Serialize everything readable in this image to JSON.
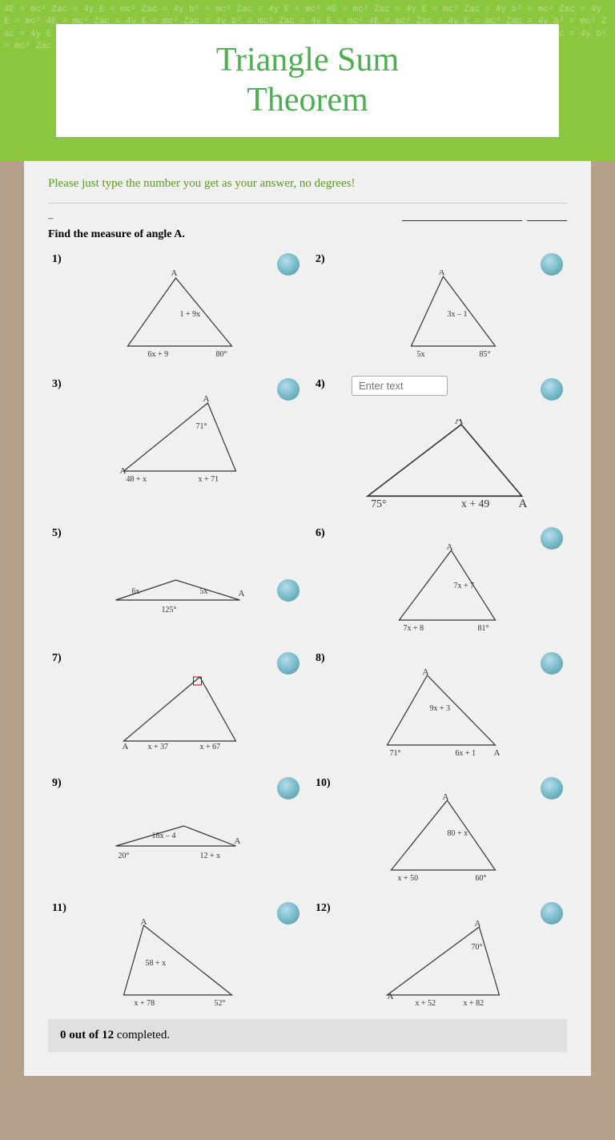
{
  "header": {
    "title": "Triangle Sum\nTheorem",
    "math_pattern": "4E = mc² Zac = 4y E = mc² Zac = 4y b²"
  },
  "instruction": "Please just type the number you get as your answer, no degrees!",
  "find_text": "Find the measure of angle A.",
  "name_label": "–",
  "completion": {
    "count": "0",
    "total": "12",
    "text": "completed."
  },
  "problems": [
    {
      "number": "1)",
      "type": "triangle",
      "angles": [
        "1 + 9x",
        "6x + 9",
        "80°"
      ],
      "vertex_label": "A",
      "has_input": false
    },
    {
      "number": "2)",
      "type": "triangle",
      "angles": [
        "3x – 1",
        "5x",
        "85°"
      ],
      "vertex_label": "A",
      "has_input": false
    },
    {
      "number": "3)",
      "type": "triangle",
      "angles": [
        "71°",
        "48 + x",
        "x + 71"
      ],
      "vertex_label": "A",
      "has_input": false
    },
    {
      "number": "4)",
      "type": "triangle",
      "angles": [
        "75°",
        "x + 49"
      ],
      "vertex_label": "A",
      "has_input": true,
      "input_placeholder": "Enter text"
    },
    {
      "number": "5)",
      "type": "flat_triangle",
      "angles": [
        "6x",
        "5x",
        "125°"
      ],
      "vertex_label": "A",
      "has_input": false
    },
    {
      "number": "6)",
      "type": "triangle",
      "angles": [
        "7x + 7",
        "7x + 8",
        "81°"
      ],
      "vertex_label": "A",
      "has_input": false
    },
    {
      "number": "7)",
      "type": "triangle",
      "angles": [
        "x + 37",
        "x + 67"
      ],
      "vertex_label": "A",
      "has_input": false
    },
    {
      "number": "8)",
      "type": "triangle",
      "angles": [
        "9x + 3",
        "71°",
        "6x + 1"
      ],
      "vertex_label": "A",
      "has_input": false
    },
    {
      "number": "9)",
      "type": "flat_triangle",
      "angles": [
        "20°",
        "18x – 4",
        "12 + x"
      ],
      "vertex_label": "A",
      "has_input": false
    },
    {
      "number": "10)",
      "type": "triangle",
      "angles": [
        "80 + x",
        "x + 50",
        "60°"
      ],
      "vertex_label": "A",
      "has_input": false
    },
    {
      "number": "11)",
      "type": "triangle",
      "angles": [
        "58 + x",
        "x + 78",
        "52°"
      ],
      "vertex_label": "A",
      "has_input": false
    },
    {
      "number": "12)",
      "type": "triangle",
      "angles": [
        "70°",
        "x + 52",
        "x + 82"
      ],
      "vertex_label": "A",
      "has_input": false
    }
  ]
}
